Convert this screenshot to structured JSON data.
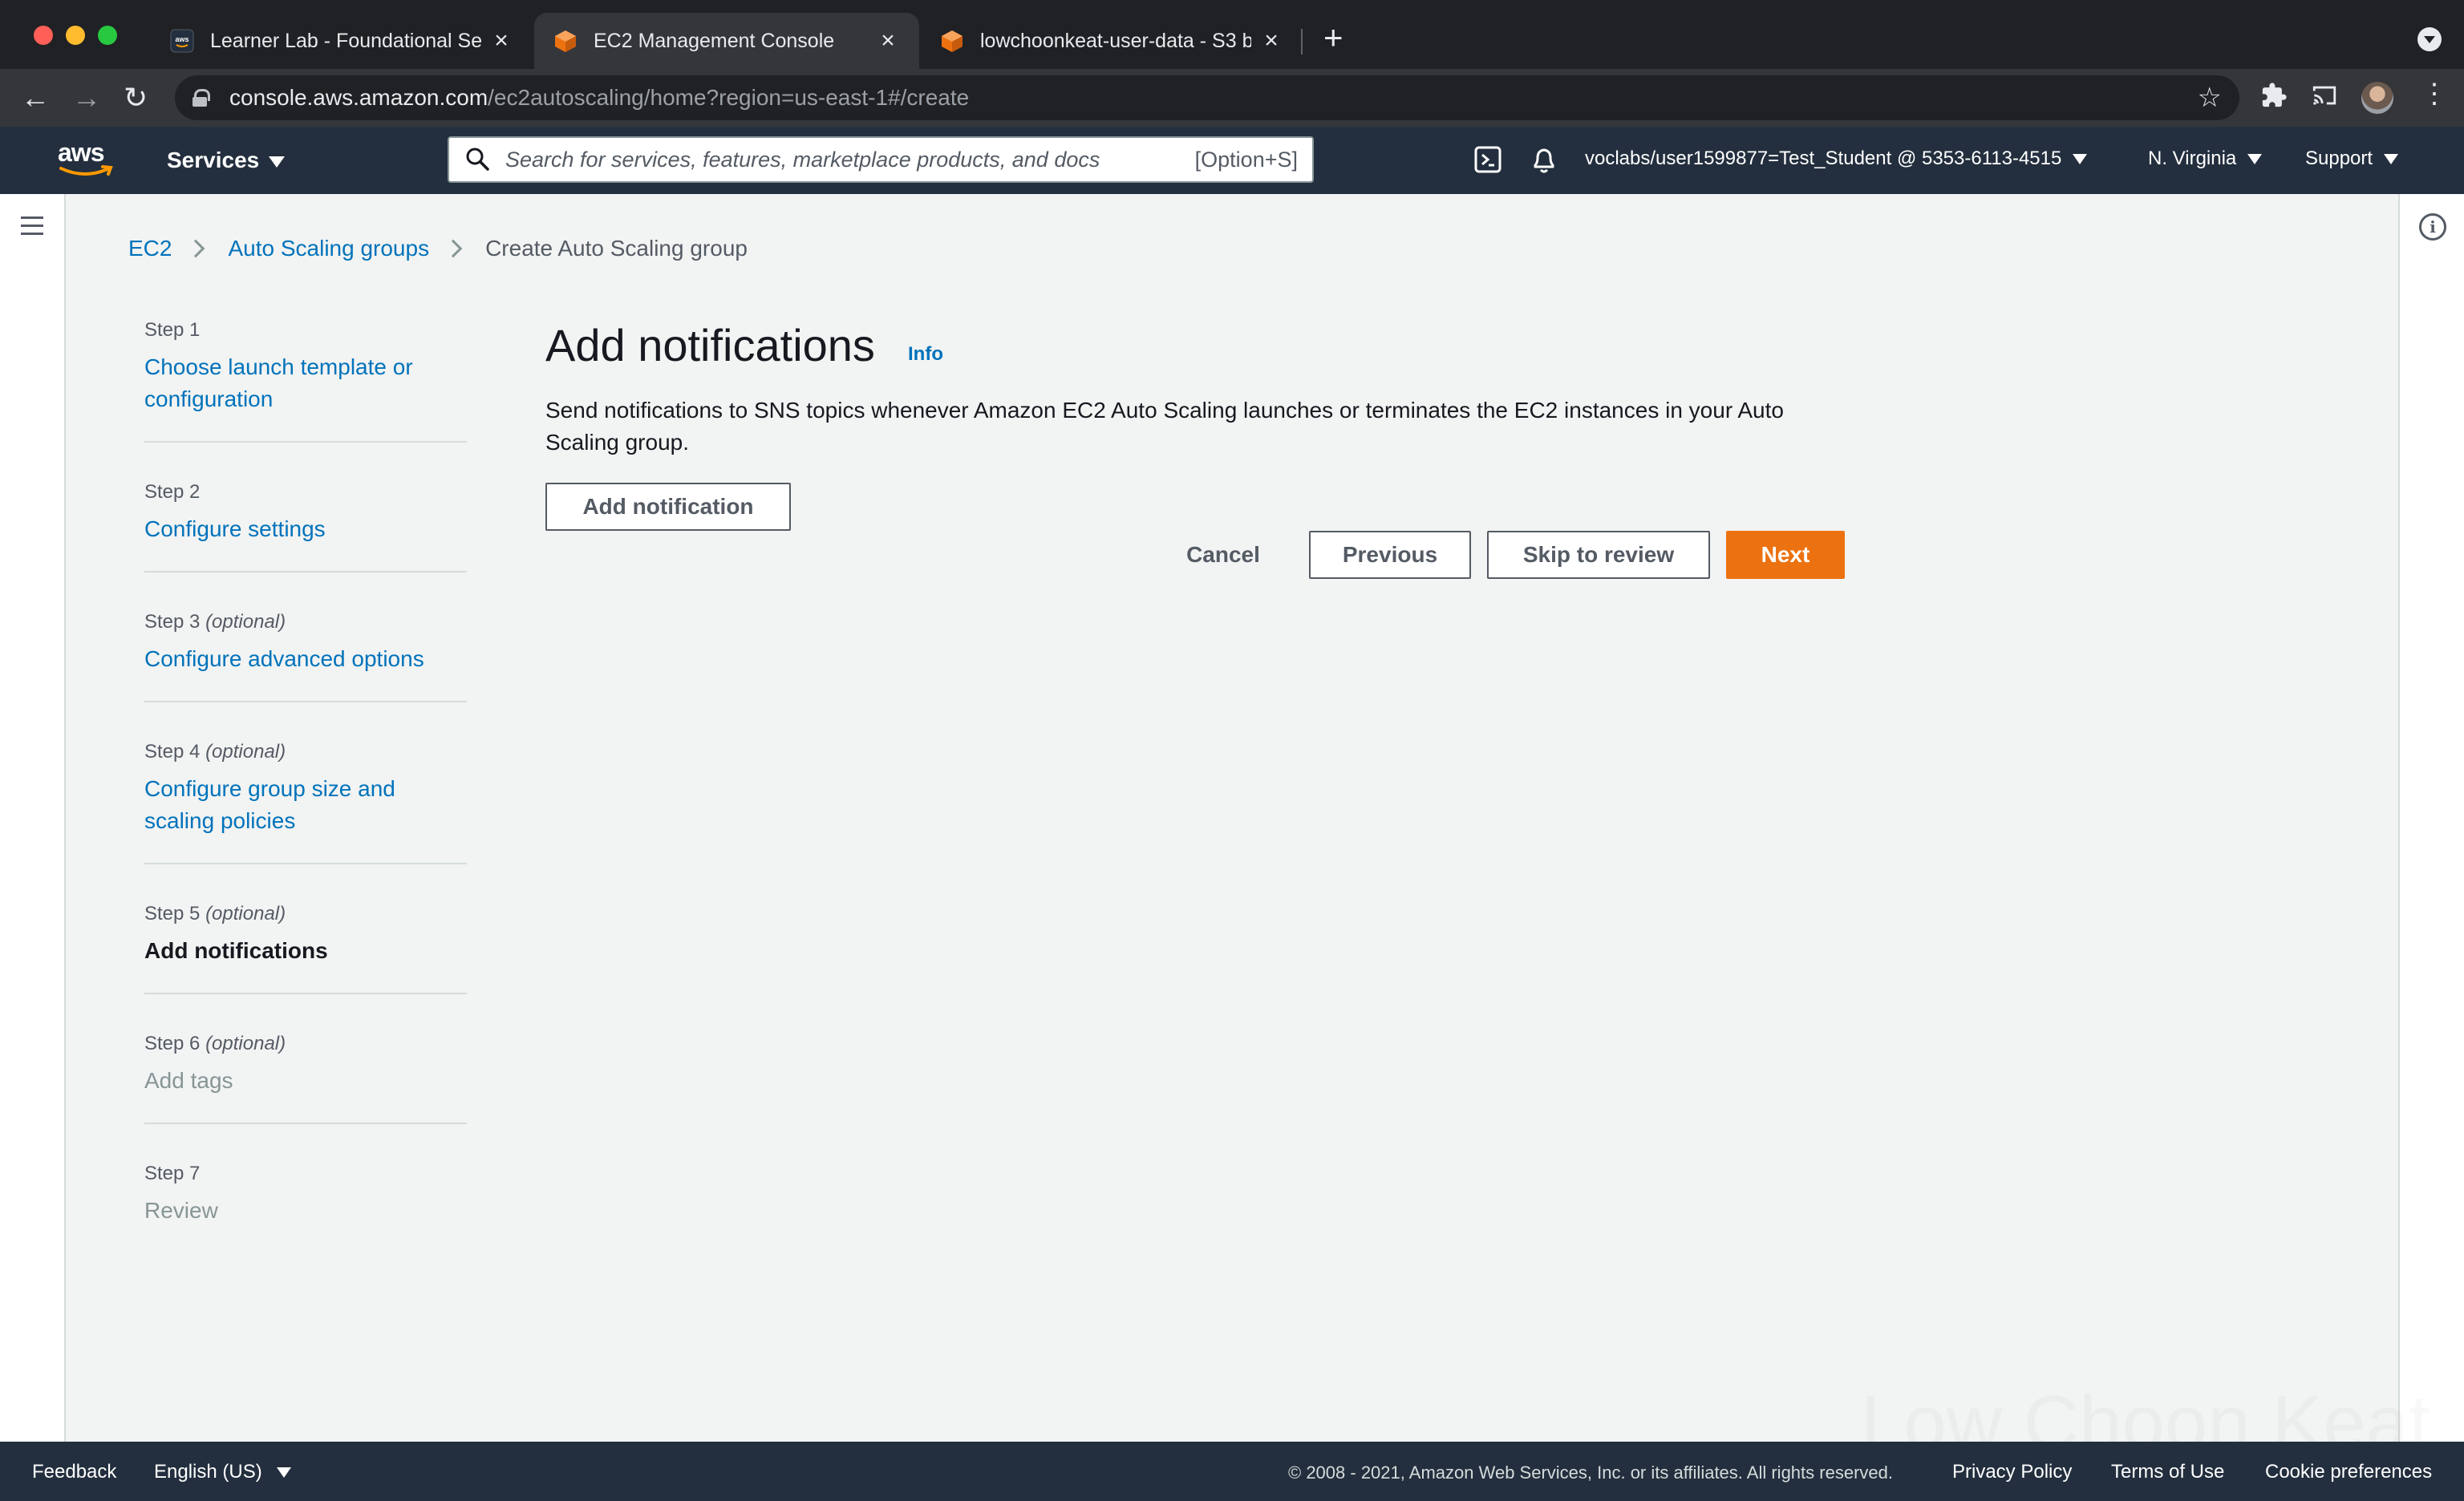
{
  "browser": {
    "tabs": [
      {
        "title": "Learner Lab - Foundational Ser",
        "favicon": "aws-icon",
        "active": false
      },
      {
        "title": "EC2 Management Console",
        "favicon": "aws-service-cube-icon",
        "active": true
      },
      {
        "title": "lowchoonkeat-user-data - S3 b",
        "favicon": "aws-service-cube-icon",
        "active": false
      }
    ],
    "url_host": "console.aws.amazon.com",
    "url_path": "/ec2autoscaling/home?region=us-east-1#/create"
  },
  "header": {
    "logo_text": "aws",
    "services_label": "Services",
    "search_placeholder": "Search for services, features, marketplace products, and docs",
    "search_shortcut": "[Option+S]",
    "account": "voclabs/user1599877=Test_Student @ 5353-6113-4515",
    "region": "N. Virginia",
    "support": "Support"
  },
  "breadcrumb": {
    "items": [
      "EC2",
      "Auto Scaling groups"
    ],
    "current": "Create Auto Scaling group"
  },
  "steps": [
    {
      "number": "Step 1",
      "optional": "",
      "label": "Choose launch template or configuration",
      "state": "link"
    },
    {
      "number": "Step 2",
      "optional": "",
      "label": "Configure settings",
      "state": "link"
    },
    {
      "number": "Step 3",
      "optional": "(optional)",
      "label": "Configure advanced options",
      "state": "link"
    },
    {
      "number": "Step 4",
      "optional": "(optional)",
      "label": "Configure group size and scaling policies",
      "state": "link"
    },
    {
      "number": "Step 5",
      "optional": "(optional)",
      "label": "Add notifications",
      "state": "current"
    },
    {
      "number": "Step 6",
      "optional": "(optional)",
      "label": "Add tags",
      "state": "disabled"
    },
    {
      "number": "Step 7",
      "optional": "",
      "label": "Review",
      "state": "disabled"
    }
  ],
  "main": {
    "title": "Add notifications",
    "info_link": "Info",
    "description": "Send notifications to SNS topics whenever Amazon EC2 Auto Scaling launches or terminates the EC2 instances in your Auto Scaling group.",
    "add_notification_label": "Add notification",
    "cancel_label": "Cancel",
    "previous_label": "Previous",
    "skip_label": "Skip to review",
    "next_label": "Next"
  },
  "footer": {
    "feedback": "Feedback",
    "language": "English (US)",
    "copyright": "© 2008 - 2021, Amazon Web Services, Inc. or its affiliates. All rights reserved.",
    "privacy": "Privacy Policy",
    "terms": "Terms of Use",
    "cookies": "Cookie preferences"
  },
  "watermark": "Low Choon Keat",
  "colors": {
    "accent_orange": "#ec7211",
    "link_blue": "#0073bb",
    "header_dark": "#232f3e"
  }
}
